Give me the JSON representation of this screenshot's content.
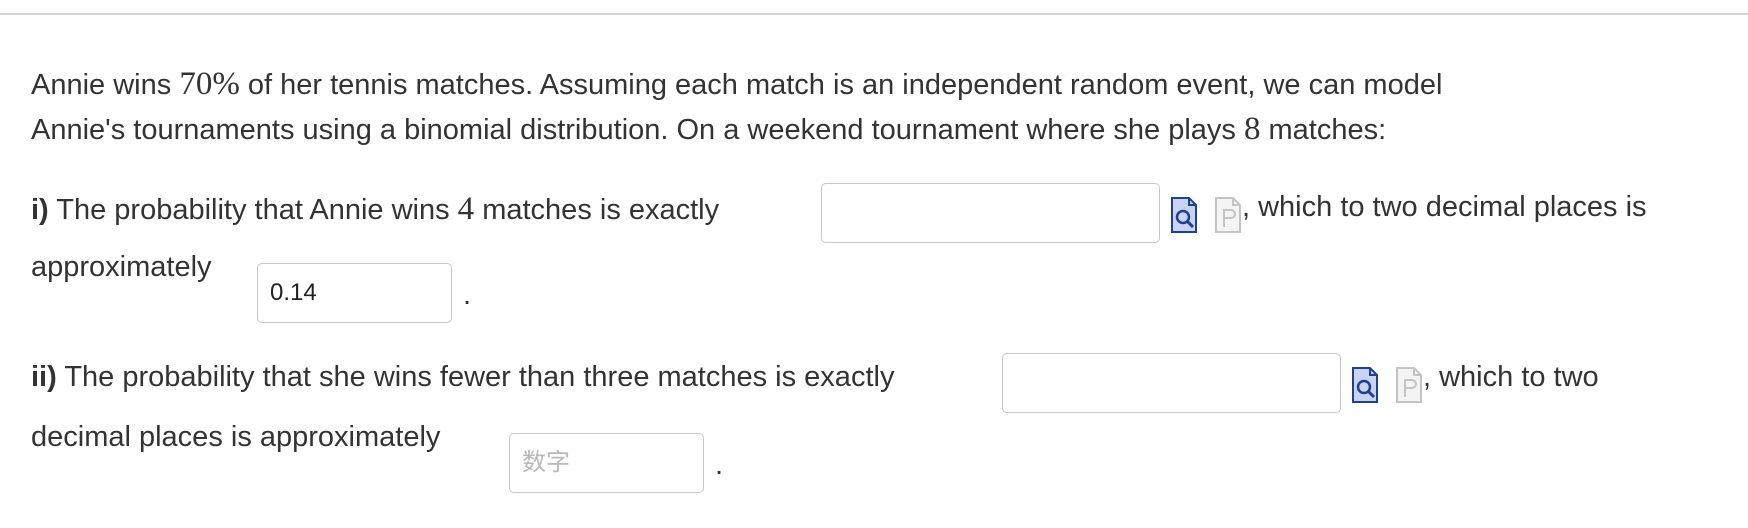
{
  "question": {
    "p1": "Annie wins ",
    "percent": "70%",
    "p2": " of her tennis matches. Assuming each match is an independent random event, we can model",
    "p3": "Annie's tournaments using a binomial distribution. On a weekend tournament where she plays ",
    "matches": "8",
    "p4": " matches:"
  },
  "part1": {
    "label": "i)",
    "text1": " The probability that Annie wins ",
    "k": "4",
    "text2": " matches is exactly",
    "exact_value": "",
    "text3": ", which to two decimal places is",
    "text4": "approximately",
    "approx_value": "0.14",
    "period": "."
  },
  "part2": {
    "label": "ii)",
    "text1": " The probability that she wins fewer than three matches is exactly",
    "exact_value": "",
    "text3": ", which to two",
    "text4": "decimal places is approximately",
    "approx_placeholder": "数字",
    "period": "."
  },
  "icons": {
    "preview": "preview-icon",
    "palette": "formula-icon"
  },
  "colors": {
    "icon_blue": "#1f3f8f",
    "icon_fill": "#c9d4f2",
    "icon_grey": "#c4c4c4",
    "border": "#c7c7c7"
  }
}
